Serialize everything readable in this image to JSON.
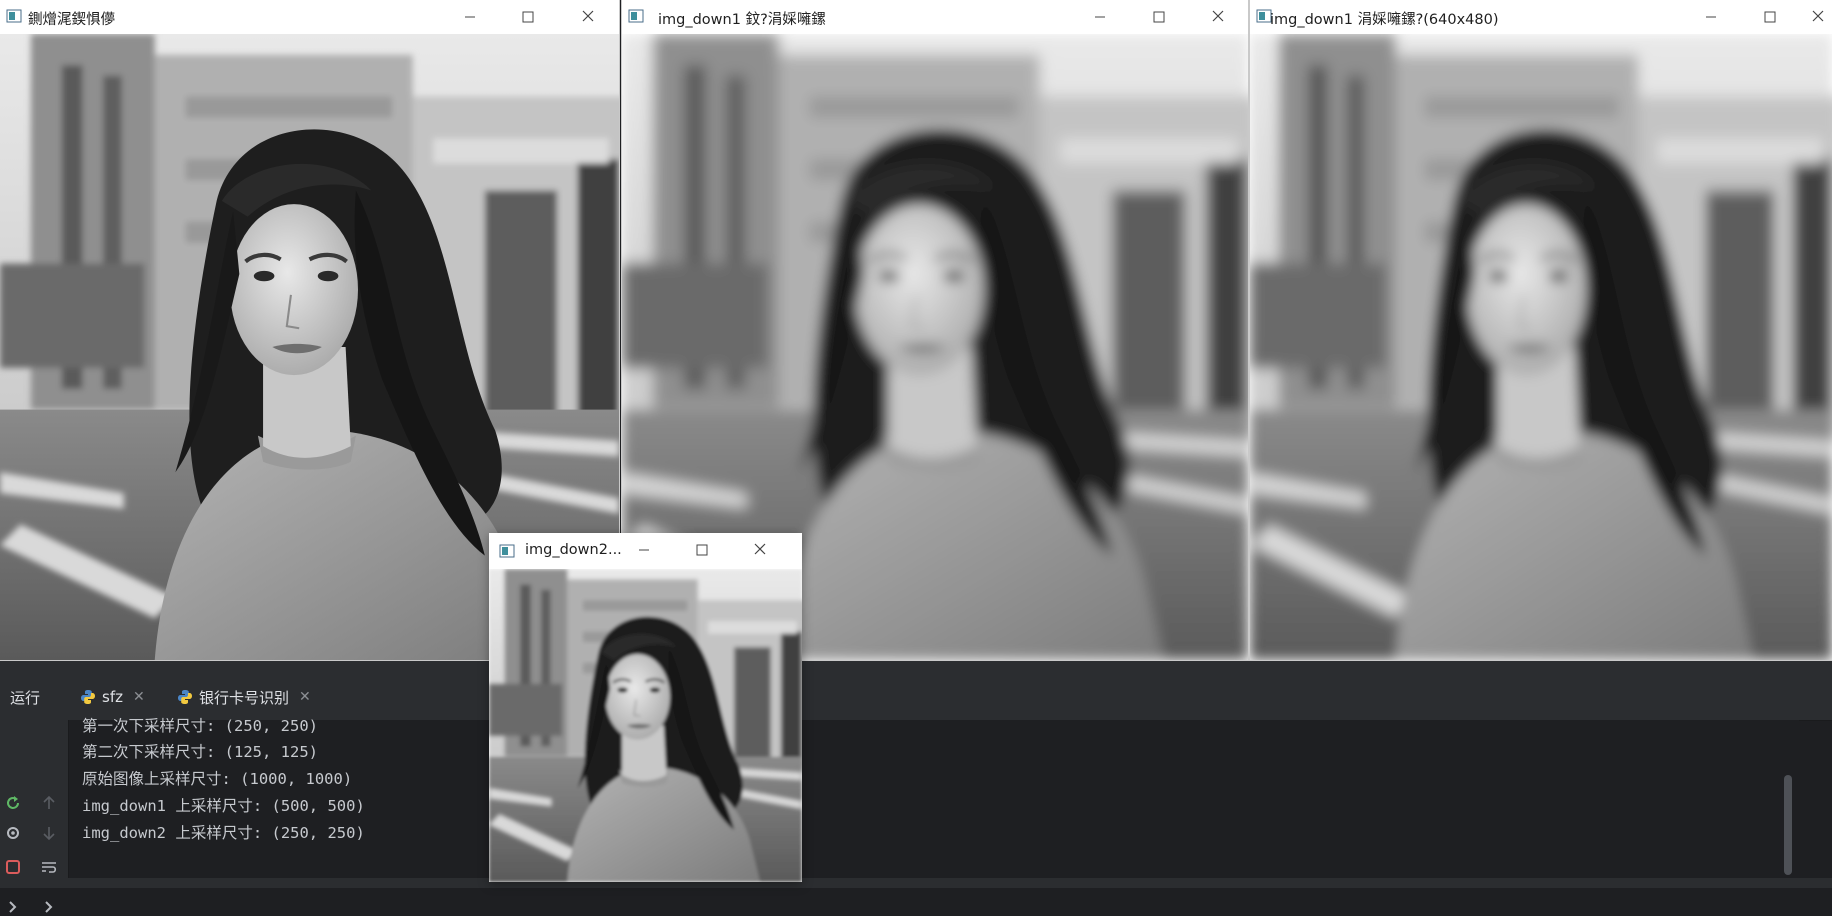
{
  "windows": {
    "win1": {
      "title": "鍘熷浘鍥惧儚"
    },
    "win2": {
      "title": "img_down1 鈫?涓婇噰鏍"
    },
    "win3": {
      "title": "img_down1 涓婇噰鏍?(640x480)"
    },
    "win4": {
      "title": "img_down2..."
    }
  },
  "ide": {
    "run_label": "运行",
    "tabs": [
      {
        "label": "sfz",
        "icon": "python-icon"
      },
      {
        "label": "银行卡号识别",
        "icon": "python-icon"
      }
    ],
    "console_lines": [
      "第一次下采样尺寸: (250, 250)",
      "第二次下采样尺寸: (125, 125)",
      "原始图像上采样尺寸: (1000, 1000)",
      "img_down1 上采样尺寸: (500, 500)",
      "img_down2 上采样尺寸: (250, 250)"
    ]
  },
  "colors": {
    "ide_bg": "#1e1f22",
    "ide_panel": "#2b2d30",
    "console_text": "#c6c9ce",
    "rerun_green": "#5fb865",
    "stop_red": "#db5c5c"
  }
}
